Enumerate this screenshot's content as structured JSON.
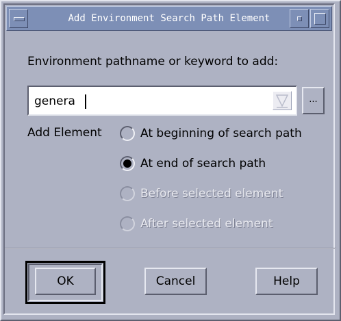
{
  "window": {
    "title": "Add Environment Search Path Element"
  },
  "prompt_label": "Environment pathname or keyword to add:",
  "path_input": {
    "value": "genera",
    "placeholder": ""
  },
  "browse_label": "...",
  "add_element": {
    "label": "Add Element",
    "options": [
      {
        "label": "At beginning of search path",
        "selected": false,
        "enabled": true
      },
      {
        "label": "At end of search path",
        "selected": true,
        "enabled": true
      },
      {
        "label": "Before selected element",
        "selected": false,
        "enabled": false
      },
      {
        "label": "After selected element",
        "selected": false,
        "enabled": false
      }
    ]
  },
  "buttons": {
    "ok": "OK",
    "cancel": "Cancel",
    "help": "Help"
  },
  "colors": {
    "background": "#aeb2c3",
    "titlebar": "#7d8fb6",
    "input_bg": "#ffffff"
  },
  "icons": [
    "window-menu-icon",
    "minimize-icon",
    "maximize-icon",
    "dropdown-arrow-icon"
  ]
}
